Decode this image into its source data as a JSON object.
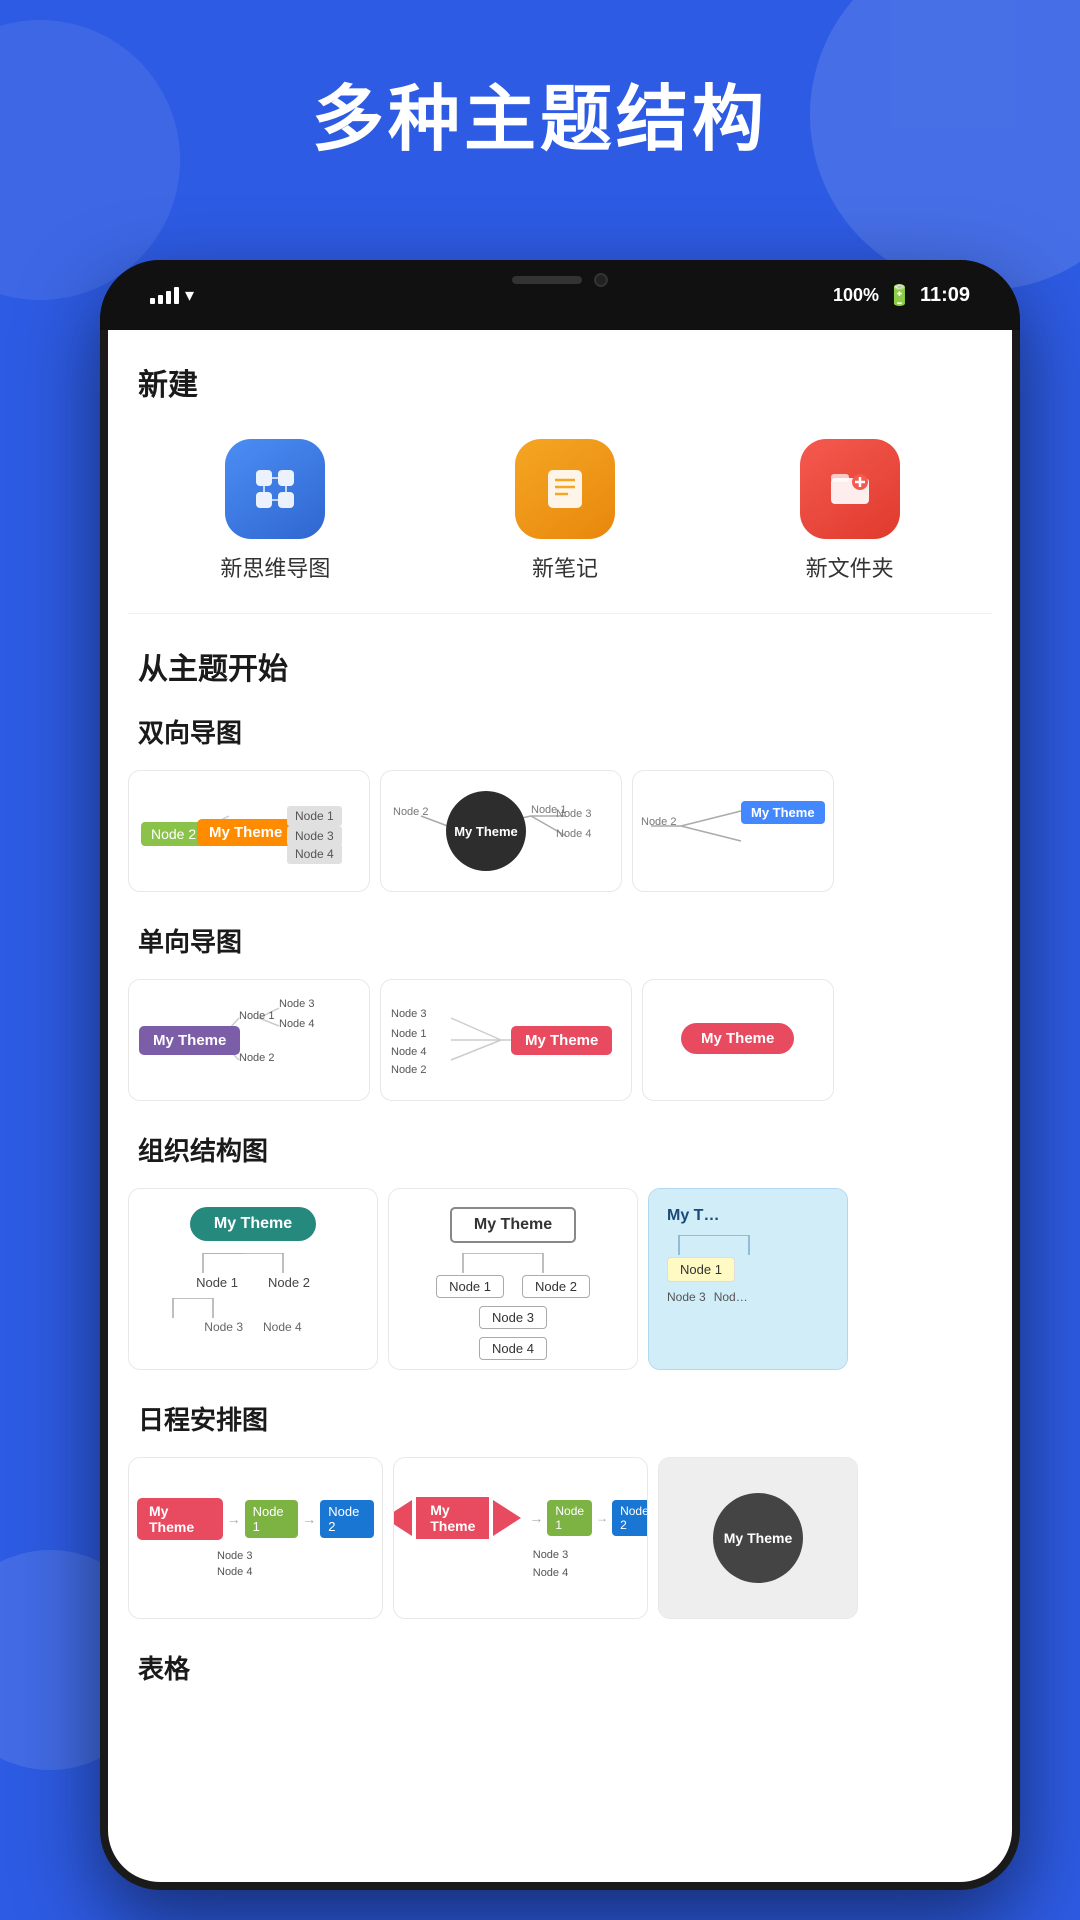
{
  "page": {
    "background_color": "#2d5be3",
    "main_title": "多种主题结构"
  },
  "status_bar": {
    "signal": "4G",
    "wifi": "wifi",
    "battery": "100%",
    "time": "11:09"
  },
  "new_section": {
    "header": "新建",
    "items": [
      {
        "label": "新思维导图",
        "icon_type": "mindmap"
      },
      {
        "label": "新笔记",
        "icon_type": "note"
      },
      {
        "label": "新文件夹",
        "icon_type": "folder"
      }
    ]
  },
  "theme_section": {
    "header": "从主题开始",
    "bidirectional": {
      "label": "双向导图",
      "cards": [
        {
          "theme": "My Theme",
          "style": "colorful-h"
        },
        {
          "theme": "My Theme",
          "style": "circle-dark"
        },
        {
          "theme": "My The",
          "style": "blue-outline"
        }
      ]
    },
    "unidirectional": {
      "label": "单向导图",
      "cards": [
        {
          "theme": "My Theme",
          "style": "purple-right"
        },
        {
          "theme": "My Theme",
          "style": "red-right"
        },
        {
          "theme": "My Theme",
          "style": "pink-oval"
        }
      ]
    },
    "org": {
      "label": "组织结构图",
      "cards": [
        {
          "theme": "My Theme",
          "style": "teal-oval"
        },
        {
          "theme": "My Theme",
          "style": "outline-tree"
        },
        {
          "theme": "My T",
          "style": "blue-bg-tree"
        }
      ]
    },
    "schedule": {
      "label": "日程安排图",
      "cards": [
        {
          "theme": "My Theme",
          "style": "red-arrow-chain"
        },
        {
          "theme": "My Theme",
          "style": "diamond-chain"
        },
        {
          "theme": "My Theme",
          "style": "dark-circle"
        }
      ]
    },
    "table": {
      "label": "表格"
    }
  },
  "nodes": {
    "node1": "Node 1",
    "node2": "Node 2",
    "node3": "Node 3",
    "node4": "Node 4",
    "my_theme": "My Theme",
    "theme": "Theme"
  }
}
